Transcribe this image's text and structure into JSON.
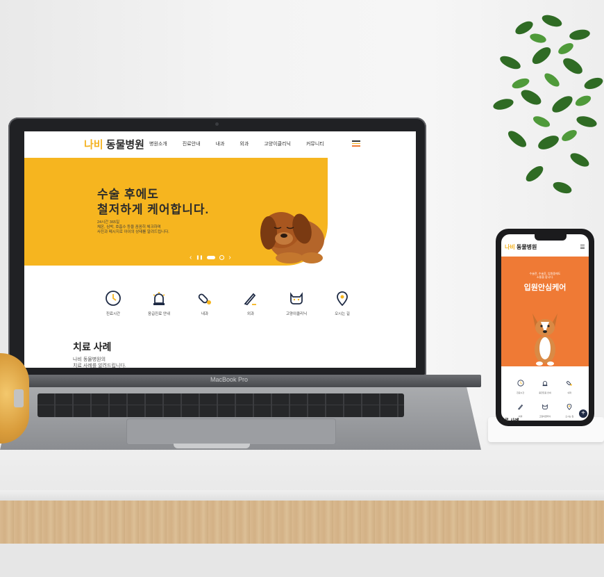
{
  "desktop_site": {
    "logo_part1": "나비",
    "logo_part2": " 동물병원",
    "menu": [
      "병원소개",
      "진료안내",
      "내과",
      "외과",
      "고양이클리닉",
      "커뮤니티"
    ],
    "hero_title": "수술 후에도\n철저하게 케어합니다.",
    "hero_sub": "24시간 365일\n체온, 심박, 호흡수 등을 꼼꼼히 체크하며\n사진과 메시지로 아이의 상태를 알려드립니다.",
    "slider_prev": "‹",
    "slider_pause": "❚❚",
    "slider_next": "›",
    "quick_menu": [
      {
        "label": "진료시간",
        "icon": "clock-icon"
      },
      {
        "label": "응급진료 안내",
        "icon": "siren-icon"
      },
      {
        "label": "내과",
        "icon": "pill-icon"
      },
      {
        "label": "외과",
        "icon": "scalpel-icon"
      },
      {
        "label": "고양이클리닉",
        "icon": "cat-icon"
      },
      {
        "label": "오시는 길",
        "icon": "location-pin-icon"
      }
    ],
    "case_title": "치료 사례",
    "case_sub": "나비 동물병원의\n치료 사례를 알려드립니다."
  },
  "laptop_label": "MacBook Pro",
  "mobile_site": {
    "logo_part1": "나비",
    "logo_part2": " 동물병원",
    "hero_sub": "수술전, 수술후, 입원중에도\n소통을 합니다.",
    "hero_title": "입원안심케어",
    "quick_menu": [
      "진료시간",
      "응급진료 안내",
      "내과",
      "외과",
      "고양이클리닉",
      "오시는 길"
    ],
    "fab": "+",
    "case_title": "치료 사례"
  },
  "colors": {
    "brand_yellow": "#f6b51f",
    "mobile_orange": "#ef7a35",
    "icon_navy": "#1e2a44"
  }
}
